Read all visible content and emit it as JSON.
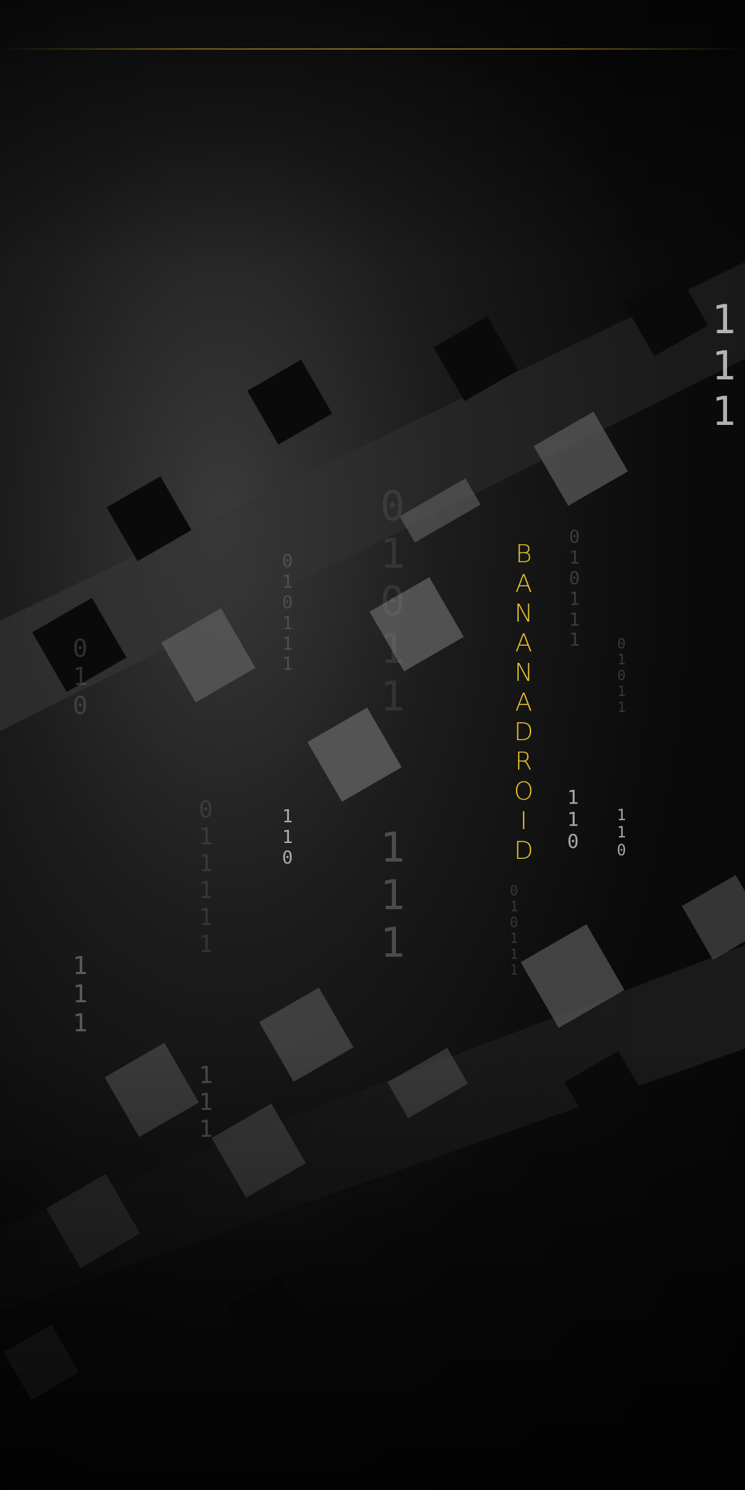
{
  "wallpaper": {
    "brand_text": "BANANADROID",
    "accent_color": "#e7c42f",
    "background_color": "#050505",
    "tile_color": "#3a3a3a",
    "digit_columns": [
      {
        "digits": [
          "1",
          "1",
          "1"
        ],
        "tone": "bright"
      },
      {
        "digits": [
          "0",
          "1",
          "0",
          "1",
          "1",
          "1"
        ],
        "tone": "dim"
      },
      {
        "digits": [
          "1",
          "1",
          "0"
        ],
        "tone": "bright"
      },
      {
        "digits": [
          "0",
          "1",
          "0",
          "1",
          "1",
          "1"
        ],
        "tone": "dim"
      },
      {
        "digits": [
          "1",
          "1",
          "0"
        ],
        "tone": "bright"
      },
      {
        "digits": [
          "0",
          "1",
          "0",
          "1",
          "1"
        ],
        "tone": "dim"
      },
      {
        "digits": [
          "1",
          "1",
          "0"
        ],
        "tone": "bright"
      },
      {
        "digits": [
          "0",
          "1",
          "0",
          "1",
          "1",
          "1"
        ],
        "tone": "dim"
      },
      {
        "digits": [
          "1",
          "1",
          "1"
        ],
        "tone": "mid"
      },
      {
        "digits": [
          "0",
          "1",
          "0",
          "1",
          "1"
        ],
        "tone": "mid"
      },
      {
        "digits": [
          "1",
          "1",
          "1"
        ],
        "tone": "mid"
      },
      {
        "digits": [
          "0",
          "1",
          "0"
        ],
        "tone": "mid"
      },
      {
        "digits": [
          "1",
          "1",
          "1"
        ],
        "tone": "mid"
      },
      {
        "digits": [
          "0",
          "1",
          "1",
          "1",
          "1",
          "1"
        ],
        "tone": "mid"
      }
    ]
  }
}
